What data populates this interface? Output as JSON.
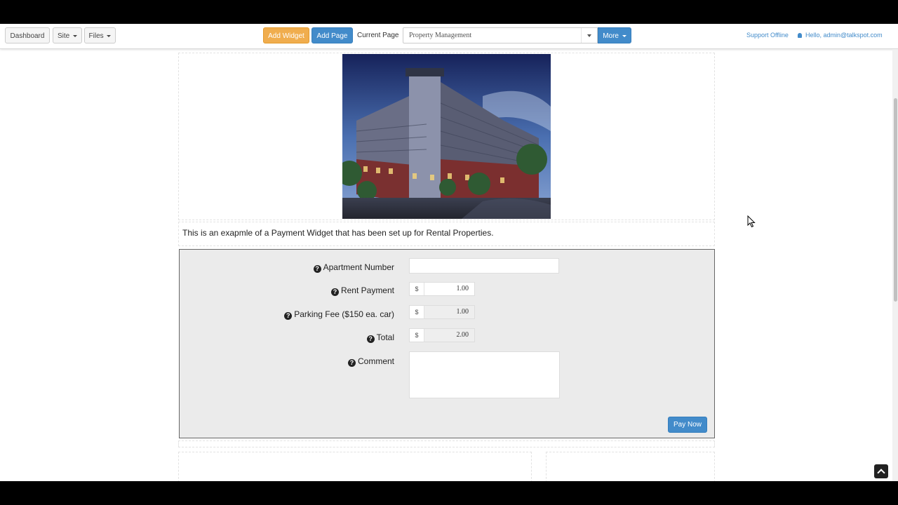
{
  "toolbar": {
    "dashboard_label": "Dashboard",
    "site_label": "Site",
    "files_label": "Files",
    "add_widget_label": "Add Widget",
    "add_page_label": "Add Page",
    "current_page_label": "Current Page",
    "current_page_value": "Property Management",
    "more_label": "More",
    "support_status": "Support Offline",
    "user_greeting": "Hello, admin@talkspot.com"
  },
  "content": {
    "intro_text": "This is an exapmle of a Payment Widget that has been set up for Rental Properties."
  },
  "form": {
    "apartment_label": "Apartment Number",
    "apartment_value": "",
    "rent_label": "Rent Payment",
    "rent_currency": "$",
    "rent_value": "1.00",
    "parking_label": "Parking Fee ($150 ea. car)",
    "parking_currency": "$",
    "parking_value": "1.00",
    "total_label": "Total",
    "total_currency": "$",
    "total_value": "2.00",
    "comment_label": "Comment",
    "comment_value": "",
    "pay_button_label": "Pay Now",
    "help_icon_glyph": "?"
  },
  "colors": {
    "accent_blue": "#428bca",
    "accent_orange": "#f0ad4e",
    "form_background": "#ebebeb"
  },
  "icons": [
    "caret-down-icon",
    "user-icon",
    "question-circle-icon",
    "chevron-up-icon",
    "mouse-cursor-icon"
  ]
}
